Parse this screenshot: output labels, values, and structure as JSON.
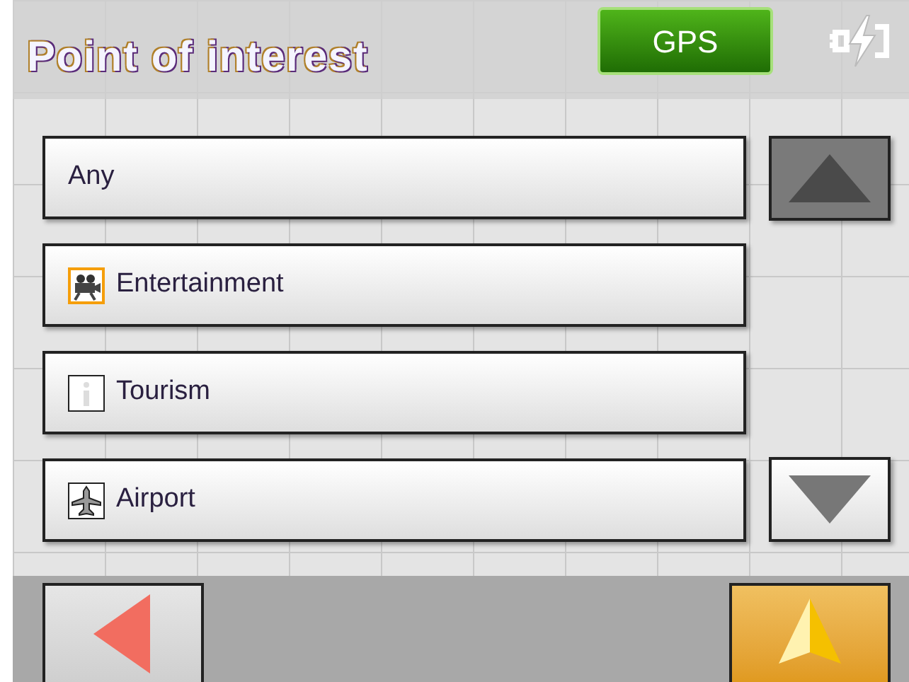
{
  "header": {
    "title": "Point of interest",
    "gps_label": "GPS"
  },
  "items": [
    {
      "label": "Any",
      "kind": "plain"
    },
    {
      "label": "Entertainment",
      "kind": "entertainment"
    },
    {
      "label": "Tourism",
      "kind": "tourism"
    },
    {
      "label": "Airport",
      "kind": "airport"
    }
  ],
  "scroll": {
    "up_disabled": true,
    "down_disabled": false
  }
}
